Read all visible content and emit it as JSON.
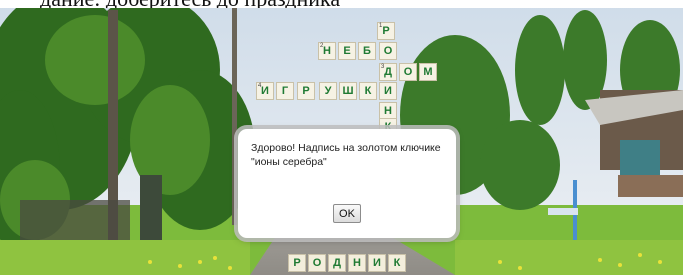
{
  "page_title_partial": "дание: доберитесь до праздника",
  "crossword": {
    "cells": [
      {
        "id": "c1",
        "letter": "Р",
        "num": "1"
      },
      {
        "id": "c2",
        "letter": "Н",
        "num": "2"
      },
      {
        "id": "c3",
        "letter": "Е",
        "num": ""
      },
      {
        "id": "c4",
        "letter": "Б",
        "num": ""
      },
      {
        "id": "c5",
        "letter": "О",
        "num": ""
      },
      {
        "id": "c6",
        "letter": "Д",
        "num": "3"
      },
      {
        "id": "c7",
        "letter": "О",
        "num": ""
      },
      {
        "id": "c8",
        "letter": "М",
        "num": ""
      },
      {
        "id": "c9",
        "letter": "И",
        "num": "4"
      },
      {
        "id": "c10",
        "letter": "Г",
        "num": ""
      },
      {
        "id": "c11",
        "letter": "Р",
        "num": ""
      },
      {
        "id": "c12",
        "letter": "У",
        "num": ""
      },
      {
        "id": "c13",
        "letter": "Ш",
        "num": ""
      },
      {
        "id": "c14",
        "letter": "К",
        "num": ""
      },
      {
        "id": "c15",
        "letter": "И",
        "num": ""
      },
      {
        "id": "c16",
        "letter": "Н",
        "num": ""
      },
      {
        "id": "c17",
        "letter": "К",
        "num": ""
      }
    ],
    "bottom_word": [
      "Р",
      "О",
      "Д",
      "Н",
      "И",
      "К"
    ]
  },
  "dialog": {
    "message": "Здорово! Надпись на золотом ключике \"ионы серебра\"",
    "ok_label": "OK"
  }
}
